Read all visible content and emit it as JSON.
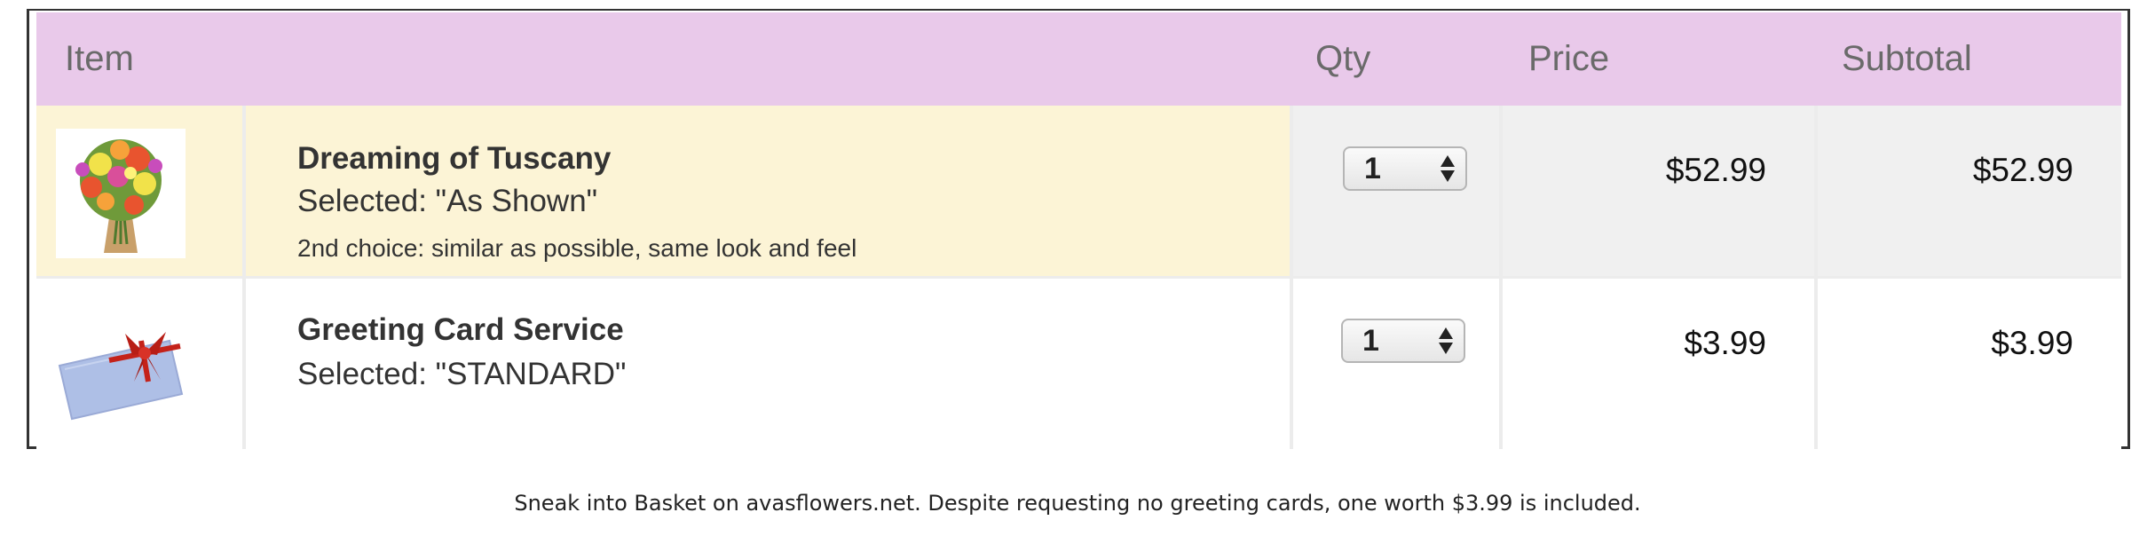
{
  "table": {
    "headers": {
      "item": "Item",
      "qty": "Qty",
      "price": "Price",
      "subtotal": "Subtotal"
    },
    "rows": [
      {
        "image_icon": "flower-bouquet-image",
        "title": "Dreaming of Tuscany",
        "selected": "Selected: \"As Shown\"",
        "note": "2nd choice: similar as possible, same look and feel",
        "qty": "1",
        "price": "$52.99",
        "subtotal": "$52.99"
      },
      {
        "image_icon": "greeting-card-image",
        "title": "Greeting Card Service",
        "selected": "Selected: \"STANDARD\"",
        "qty": "1",
        "price": "$3.99",
        "subtotal": "$3.99"
      }
    ]
  },
  "caption": "Sneak into Basket on avasflowers.net. Despite requesting no greeting cards, one worth $3.99 is included.",
  "colors": {
    "header_bg": "#e9c9ea",
    "highlight_row_bg": "#fcf4d6",
    "cell_gray_bg": "#f0f0f0"
  }
}
